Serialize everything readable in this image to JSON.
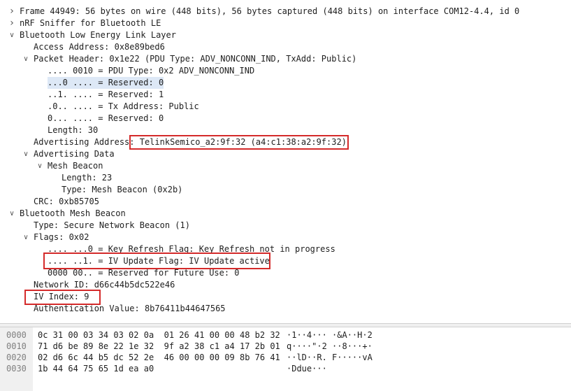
{
  "tree": [
    {
      "indent": 0,
      "expander": "collapsed",
      "text": "Frame 44949: 56 bytes on wire (448 bits), 56 bytes captured (448 bits) on interface COM12-4.4, id 0"
    },
    {
      "indent": 0,
      "expander": "collapsed",
      "text": "nRF Sniffer for Bluetooth LE"
    },
    {
      "indent": 0,
      "expander": "expanded",
      "text": "Bluetooth Low Energy Link Layer"
    },
    {
      "indent": 1,
      "expander": "none",
      "text": "Access Address: 0x8e89bed6"
    },
    {
      "indent": 1,
      "expander": "expanded",
      "text": "Packet Header: 0x1e22 (PDU Type: ADV_NONCONN_IND, TxAdd: Public)"
    },
    {
      "indent": 2,
      "expander": "none",
      "text": ".... 0010 = PDU Type: 0x2 ADV_NONCONN_IND"
    },
    {
      "indent": 2,
      "expander": "none",
      "text": "...0 .... = Reserved: 0",
      "selected": true
    },
    {
      "indent": 2,
      "expander": "none",
      "text": "..1. .... = Reserved: 1"
    },
    {
      "indent": 2,
      "expander": "none",
      "text": ".0.. .... = Tx Address: Public"
    },
    {
      "indent": 2,
      "expander": "none",
      "text": "0... .... = Reserved: 0"
    },
    {
      "indent": 2,
      "expander": "none",
      "text": "Length: 30"
    },
    {
      "indent": 1,
      "expander": "none",
      "text": "Advertising Address: TelinkSemico_a2:9f:32 (a4:c1:38:a2:9f:32)"
    },
    {
      "indent": 1,
      "expander": "expanded",
      "text": "Advertising Data"
    },
    {
      "indent": 2,
      "expander": "expanded",
      "text": "Mesh Beacon"
    },
    {
      "indent": 3,
      "expander": "none",
      "text": "Length: 23"
    },
    {
      "indent": 3,
      "expander": "none",
      "text": "Type: Mesh Beacon (0x2b)"
    },
    {
      "indent": 1,
      "expander": "none",
      "text": "CRC: 0xb85705"
    },
    {
      "indent": 0,
      "expander": "expanded",
      "text": "Bluetooth Mesh Beacon"
    },
    {
      "indent": 1,
      "expander": "none",
      "text": "Type: Secure Network Beacon (1)"
    },
    {
      "indent": 1,
      "expander": "expanded",
      "text": "Flags: 0x02"
    },
    {
      "indent": 2,
      "expander": "none",
      "text": ".... ...0 = Key Refresh Flag: Key Refresh not in progress"
    },
    {
      "indent": 2,
      "expander": "none",
      "text": ".... ..1. = IV Update Flag: IV Update active"
    },
    {
      "indent": 2,
      "expander": "none",
      "text": "0000 00.. = Reserved for Future Use: 0"
    },
    {
      "indent": 1,
      "expander": "none",
      "text": "Network ID: d66c44b5dc522e46"
    },
    {
      "indent": 1,
      "expander": "none",
      "text": "IV Index: 9"
    },
    {
      "indent": 1,
      "expander": "none",
      "text": "Authentication Value: 8b76411b44647565"
    }
  ],
  "hex_rows": [
    {
      "offset": "0000",
      "bytes": "0c 31 00 03 34 03 02 0a  01 26 41 00 00 48 b2 32",
      "ascii": "·1··4··· ·&A··H·2"
    },
    {
      "offset": "0010",
      "bytes": "71 d6 be 89 8e 22 1e 32  9f a2 38 c1 a4 17 2b 01",
      "ascii": "q····\"·2 ··8···+·"
    },
    {
      "offset": "0020",
      "bytes": "02 d6 6c 44 b5 dc 52 2e  46 00 00 00 09 8b 76 41",
      "ascii": "··lD··R. F·····vA"
    },
    {
      "offset": "0030",
      "bytes": "1b 44 64 75 65 1d ea a0",
      "ascii": "·Ddue···"
    }
  ],
  "colors": {
    "highlight_box": "#d42a2a",
    "selection": "#dde8f6",
    "gutter": "#f0f0f0"
  }
}
